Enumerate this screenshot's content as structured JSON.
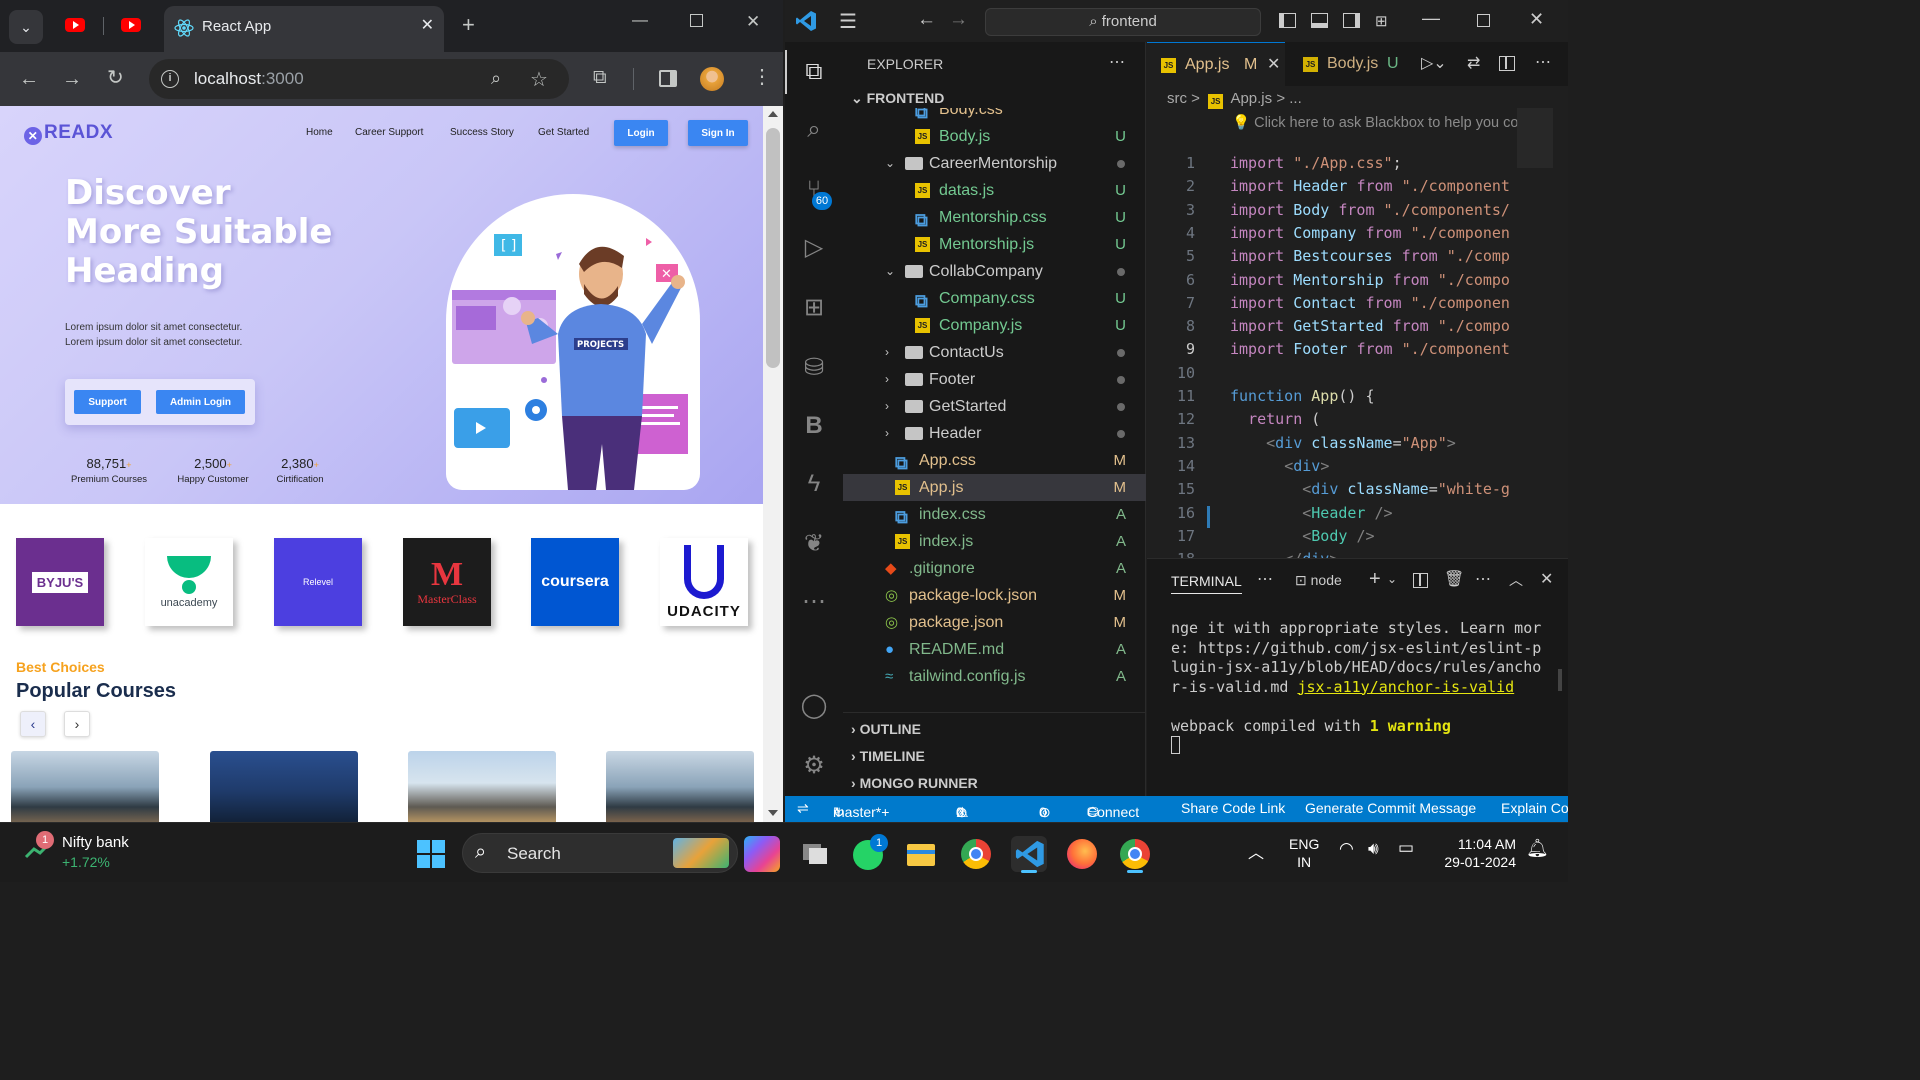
{
  "browser": {
    "tab_title": "React App",
    "new_tab_glyph": "+",
    "url_host": "localhost",
    "url_port": ":3000"
  },
  "site": {
    "logo_text": "READX",
    "nav": [
      "Home",
      "Career Support",
      "Success Story",
      "Get Started"
    ],
    "login_label": "Login",
    "signin_label": "Sign In",
    "hero_heading_1": "Discover",
    "hero_heading_2": "More Suitable",
    "hero_heading_3": "Heading",
    "lorem_1": "Lorem ipsum dolor sit amet consectetur.",
    "lorem_2": "Lorem ipsum dolor sit amet consectetur.",
    "support_label": "Support",
    "admin_label": "Admin Login",
    "stats": [
      {
        "value": "88,751",
        "suffix": "+",
        "label": "Premium Courses"
      },
      {
        "value": "2,500",
        "suffix": "+",
        "label": "Happy Customer"
      },
      {
        "value": "2,380",
        "suffix": "+",
        "label": "Cirtification"
      }
    ],
    "illustration_badge": "PROJECTS",
    "partner_logos": [
      "BYJU'S",
      "unacademy",
      "Relevel",
      "MasterClass",
      "coursera",
      "UDACITY"
    ],
    "best_choices": "Best Choices",
    "popular_courses": "Popular Courses",
    "prev_glyph": "‹",
    "next_glyph": "›"
  },
  "vscode": {
    "search_text": "frontend",
    "explorer_title": "EXPLORER",
    "root_folder": "FRONTEND",
    "truncated_row": "Body.css",
    "files": [
      {
        "name": "Body.js",
        "type": "js",
        "status": "U"
      },
      {
        "name": "CareerMentorship",
        "type": "folder-open",
        "status": "dot"
      },
      {
        "name": "datas.js",
        "type": "js",
        "status": "U"
      },
      {
        "name": "Mentorship.css",
        "type": "css",
        "status": "U"
      },
      {
        "name": "Mentorship.js",
        "type": "js",
        "status": "U"
      },
      {
        "name": "CollabCompany",
        "type": "folder-open",
        "status": "dot"
      },
      {
        "name": "Company.css",
        "type": "css",
        "status": "U"
      },
      {
        "name": "Company.js",
        "type": "js",
        "status": "U"
      },
      {
        "name": "ContactUs",
        "type": "folder",
        "status": "dot"
      },
      {
        "name": "Footer",
        "type": "folder",
        "status": "dot"
      },
      {
        "name": "GetStarted",
        "type": "folder",
        "status": "dot"
      },
      {
        "name": "Header",
        "type": "folder",
        "status": "dot"
      },
      {
        "name": "App.css",
        "type": "css",
        "status": "M"
      },
      {
        "name": "App.js",
        "type": "js",
        "status": "M"
      },
      {
        "name": "index.css",
        "type": "css",
        "status": "A"
      },
      {
        "name": "index.js",
        "type": "js",
        "status": "A"
      },
      {
        "name": ".gitignore",
        "type": "git",
        "status": "A"
      },
      {
        "name": "package-lock.json",
        "type": "json",
        "status": "M"
      },
      {
        "name": "package.json",
        "type": "json",
        "status": "M"
      },
      {
        "name": "README.md",
        "type": "info",
        "status": "A"
      },
      {
        "name": "tailwind.config.js",
        "type": "tw",
        "status": "A"
      }
    ],
    "sections": [
      "OUTLINE",
      "TIMELINE",
      "MONGO RUNNER"
    ],
    "scm_badge": "60",
    "tabs": [
      {
        "name": "App.js",
        "status": "M"
      },
      {
        "name": "Body.js",
        "status": "U"
      }
    ],
    "breadcrumb_src": "src",
    "breadcrumb_sep": ">",
    "breadcrumb_file": "App.js",
    "breadcrumb_more": "> ...",
    "hint": "Click here to ask Blackbox to help you co",
    "code_lines": [
      "import \"./App.css\";",
      "import Header from \"./component",
      "import Body from \"./components/",
      "import Company from \"./componen",
      "import Bestcourses from \"./comp",
      "import Mentorship from \"./compo",
      "import Contact from \"./componen",
      "import GetStarted from \"./compo",
      "import Footer from \"./component",
      "",
      "function App() {",
      "  return (",
      "    <div className=\"App\">",
      "      <div>",
      "        <div className=\"white-g",
      "        <Header />",
      "        <Body />",
      "      </div>"
    ],
    "terminal_title": "TERMINAL",
    "terminal_shell": "node",
    "terminal_lines": [
      "nge it with appropriate styles. Learn mor",
      "e: https://github.com/jsx-eslint/eslint-p",
      "lugin-jsx-a11y/blob/HEAD/docs/rules/ancho",
      "r-is-valid.md "
    ],
    "terminal_link": "jsx-a11y/anchor-is-valid",
    "terminal_compiled": "webpack compiled with ",
    "terminal_warning": "1 warning",
    "status": {
      "branch": "master*+",
      "errors": "0",
      "warnings": "0",
      "ports": "0",
      "connect": "Connect",
      "share": "Share Code Link",
      "commit": "Generate Commit Message",
      "explain": "Explain Co"
    }
  },
  "taskbar": {
    "stock_name": "Nifty bank",
    "stock_change": "+1.72%",
    "stock_badge": "1",
    "search_label": "Search",
    "whatsapp_badge": "1",
    "lang_1": "ENG",
    "lang_2": "IN",
    "time": "11:04 AM",
    "date": "29-01-2024"
  },
  "colors": {
    "accent_blue": "#3a86f2",
    "status_bar": "#007acc",
    "hero_purple": "#a9a5f1"
  }
}
